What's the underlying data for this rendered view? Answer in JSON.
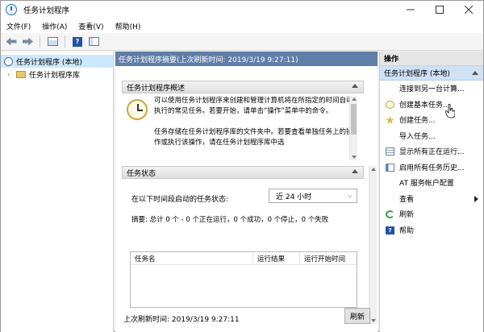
{
  "window": {
    "title": "任务计划程序",
    "minimize_icon": "minimize-icon",
    "maximize_icon": "maximize-icon",
    "close_icon": "close-icon"
  },
  "menubar": {
    "items": [
      "文件(F)",
      "操作(A)",
      "查看(V)",
      "帮助(H)"
    ]
  },
  "toolbar": {
    "icons": [
      "back-arrow-icon",
      "forward-arrow-icon",
      "console-tree-icon",
      "help-icon",
      "show-pane-icon"
    ],
    "help_glyph": "?"
  },
  "tree": {
    "root": "任务计划程序 (本地)",
    "child": "任务计划程序库"
  },
  "middle": {
    "header": "任务计划程序摘要(上次刷新时间: 2019/3/19 9:27:11)",
    "overview": {
      "title": "任务计划程序概述",
      "paragraph1": "可以使用任务计划程序来创建和管理计算机将在所指定的时间自动执行的常见任务。若要开始，请单击“操作”菜单中的命令。",
      "paragraph2": "任务存储在任务计划程序库的文件夹中。若要查看单独任务上的操作或执行该操作，请在任务计划程序库中选"
    },
    "status": {
      "title": "任务状态",
      "label": "在以下时间段启动的任务状态:",
      "select_value": "近 24 小时",
      "summary": "摘要: 总计 0 个 - 0 个正在运行，0 个成功，0 个停止，0 个失败",
      "columns": [
        "任务名",
        "运行结果",
        "运行开始时间"
      ]
    },
    "footer": {
      "last_refresh": "上次刷新时间: 2019/3/19 9:27:11",
      "refresh_button": "刷新"
    }
  },
  "actions": {
    "header": "操作",
    "group": "任务计划程序 (本地)",
    "items": [
      {
        "label": "连接到另一台计算...",
        "icon": ""
      },
      {
        "label": "创建基本任务...",
        "icon": "basic-task-icon"
      },
      {
        "label": "创建任务...",
        "icon": "create-task-icon"
      },
      {
        "label": "导入任务...",
        "icon": ""
      },
      {
        "label": "显示所有正在运行...",
        "icon": "running-tasks-icon"
      },
      {
        "label": "启用所有任务历史...",
        "icon": "task-history-icon"
      },
      {
        "label": "AT 服务帐户配置",
        "icon": ""
      },
      {
        "label": "查看",
        "icon": "",
        "submenu": true
      },
      {
        "label": "刷新",
        "icon": "refresh-icon"
      },
      {
        "label": "帮助",
        "icon": "help-icon"
      }
    ],
    "help_glyph": "?"
  }
}
